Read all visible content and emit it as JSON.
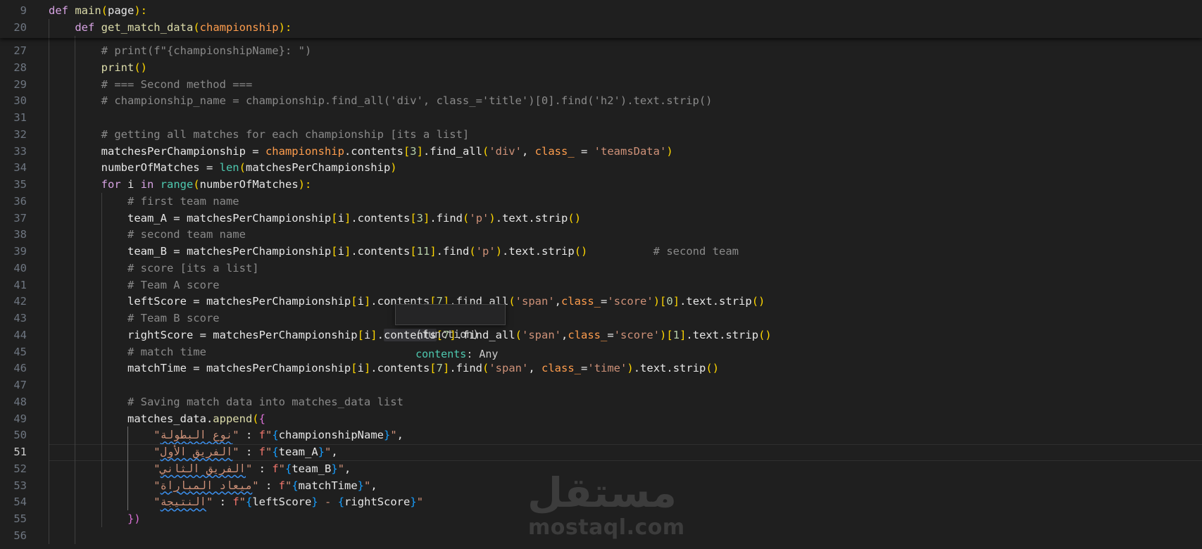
{
  "editor": {
    "sticky_lines": [
      {
        "number": "9",
        "tokens": [
          [
            "kw",
            "def "
          ],
          [
            "fn",
            "main"
          ],
          [
            "b1",
            "("
          ],
          [
            "var",
            "page"
          ],
          [
            "b1",
            "):"
          ]
        ]
      },
      {
        "number": "20",
        "tokens": [
          [
            "kw",
            "    def "
          ],
          [
            "fn",
            "get_match_data"
          ],
          [
            "b1",
            "("
          ],
          [
            "prm",
            "championship"
          ],
          [
            "b1",
            "):"
          ]
        ]
      }
    ],
    "active_line": "51",
    "lines": [
      {
        "number": "27",
        "tokens": [
          [
            "cm",
            "        # print(f\"{championshipName}: \")"
          ]
        ]
      },
      {
        "number": "28",
        "tokens": [
          [
            "fn",
            "        print"
          ],
          [
            "b1",
            "()"
          ]
        ]
      },
      {
        "number": "29",
        "tokens": [
          [
            "cm",
            "        # === Second method ==="
          ]
        ]
      },
      {
        "number": "30",
        "tokens": [
          [
            "cm",
            "        # championship_name = championship.find_all('div', class_='title')[0].find('h2').text.strip()"
          ]
        ]
      },
      {
        "number": "31",
        "tokens": []
      },
      {
        "number": "32",
        "tokens": [
          [
            "cm",
            "        # getting all matches for each championship [its a list]"
          ]
        ]
      },
      {
        "number": "33",
        "tokens": [
          [
            "var",
            "        matchesPerChampionship = "
          ],
          [
            "prm",
            "championship"
          ],
          [
            "var",
            ".contents"
          ],
          [
            "b1",
            "["
          ],
          [
            "num",
            "3"
          ],
          [
            "b1",
            "]"
          ],
          [
            "var",
            ".find_all"
          ],
          [
            "b1",
            "("
          ],
          [
            "str",
            "'div'"
          ],
          [
            "var",
            ", "
          ],
          [
            "prm",
            "class_"
          ],
          [
            "var",
            " = "
          ],
          [
            "str",
            "'teamsData'"
          ],
          [
            "b1",
            ")"
          ]
        ]
      },
      {
        "number": "34",
        "tokens": [
          [
            "var",
            "        numberOfMatches = "
          ],
          [
            "bi",
            "len"
          ],
          [
            "b1",
            "("
          ],
          [
            "var",
            "matchesPerChampionship"
          ],
          [
            "b1",
            ")"
          ]
        ]
      },
      {
        "number": "35",
        "tokens": [
          [
            "kw",
            "        for "
          ],
          [
            "var",
            "i "
          ],
          [
            "kw",
            "in "
          ],
          [
            "bi",
            "range"
          ],
          [
            "b1",
            "("
          ],
          [
            "var",
            "numberOfMatches"
          ],
          [
            "b1",
            "):"
          ]
        ]
      },
      {
        "number": "36",
        "tokens": [
          [
            "cm",
            "            # first team name"
          ]
        ]
      },
      {
        "number": "37",
        "tokens": [
          [
            "var",
            "            team_A = matchesPerChampionship"
          ],
          [
            "b1",
            "["
          ],
          [
            "var",
            "i"
          ],
          [
            "b1",
            "]"
          ],
          [
            "var",
            ".contents"
          ],
          [
            "b1",
            "["
          ],
          [
            "num",
            "3"
          ],
          [
            "b1",
            "]"
          ],
          [
            "var",
            ".find"
          ],
          [
            "b1",
            "("
          ],
          [
            "str",
            "'p'"
          ],
          [
            "b1",
            ")"
          ],
          [
            "var",
            ".text.strip"
          ],
          [
            "b1",
            "()"
          ]
        ]
      },
      {
        "number": "38",
        "tokens": [
          [
            "cm",
            "            # second team name"
          ]
        ]
      },
      {
        "number": "39",
        "tokens": [
          [
            "var",
            "            team_B = matchesPerChampionship"
          ],
          [
            "b1",
            "["
          ],
          [
            "var",
            "i"
          ],
          [
            "b1",
            "]"
          ],
          [
            "var",
            ".contents"
          ],
          [
            "b1",
            "["
          ],
          [
            "num",
            "11"
          ],
          [
            "b1",
            "]"
          ],
          [
            "var",
            ".find"
          ],
          [
            "b1",
            "("
          ],
          [
            "str",
            "'p'"
          ],
          [
            "b1",
            ")"
          ],
          [
            "var",
            ".text.strip"
          ],
          [
            "b1",
            "()"
          ],
          [
            "cm",
            "          # second team"
          ]
        ]
      },
      {
        "number": "40",
        "tokens": [
          [
            "cm",
            "            # score [its a list]"
          ]
        ]
      },
      {
        "number": "41",
        "tokens": [
          [
            "cm",
            "            # Team A score"
          ]
        ]
      },
      {
        "number": "42",
        "tokens": [
          [
            "var",
            "            leftScore = matchesPerChampionship"
          ],
          [
            "b1",
            "["
          ],
          [
            "var",
            "i"
          ],
          [
            "b1",
            "]"
          ],
          [
            "var",
            ".contents"
          ],
          [
            "b1",
            "["
          ],
          [
            "num",
            "7"
          ],
          [
            "b1",
            "]"
          ],
          [
            "var",
            ".find_all"
          ],
          [
            "b1",
            "("
          ],
          [
            "str",
            "'span'"
          ],
          [
            "var",
            ","
          ],
          [
            "prm",
            "class_"
          ],
          [
            "var",
            "="
          ],
          [
            "str",
            "'score'"
          ],
          [
            "b1",
            ")"
          ],
          [
            "b1",
            "["
          ],
          [
            "num",
            "0"
          ],
          [
            "b1",
            "]"
          ],
          [
            "var",
            ".text.strip"
          ],
          [
            "b1",
            "()"
          ]
        ]
      },
      {
        "number": "43",
        "tokens": [
          [
            "cm",
            "            # Team B score"
          ]
        ]
      },
      {
        "number": "44",
        "tokens": [
          [
            "var",
            "            rightScore = matchesPerChampionship"
          ],
          [
            "b1",
            "["
          ],
          [
            "var",
            "i"
          ],
          [
            "b1",
            "]"
          ],
          [
            "var",
            "."
          ],
          [
            "hover",
            "contents"
          ],
          [
            "b1",
            "["
          ],
          [
            "num",
            "7"
          ],
          [
            "b1",
            "]"
          ],
          [
            "var",
            ".find_all"
          ],
          [
            "b1",
            "("
          ],
          [
            "str",
            "'span'"
          ],
          [
            "var",
            ","
          ],
          [
            "prm",
            "class_"
          ],
          [
            "var",
            "="
          ],
          [
            "str",
            "'score'"
          ],
          [
            "b1",
            ")"
          ],
          [
            "b1",
            "["
          ],
          [
            "num",
            "1"
          ],
          [
            "b1",
            "]"
          ],
          [
            "var",
            ".text.strip"
          ],
          [
            "b1",
            "()"
          ]
        ]
      },
      {
        "number": "45",
        "tokens": [
          [
            "cm",
            "            # match time"
          ]
        ]
      },
      {
        "number": "46",
        "tokens": [
          [
            "var",
            "            matchTime = matchesPerChampionship"
          ],
          [
            "b1",
            "["
          ],
          [
            "var",
            "i"
          ],
          [
            "b1",
            "]"
          ],
          [
            "var",
            ".contents"
          ],
          [
            "b1",
            "["
          ],
          [
            "num",
            "7"
          ],
          [
            "b1",
            "]"
          ],
          [
            "var",
            ".find"
          ],
          [
            "b1",
            "("
          ],
          [
            "str",
            "'span'"
          ],
          [
            "var",
            ", "
          ],
          [
            "prm",
            "class_"
          ],
          [
            "var",
            "="
          ],
          [
            "str",
            "'time'"
          ],
          [
            "b1",
            ")"
          ],
          [
            "var",
            ".text.strip"
          ],
          [
            "b1",
            "()"
          ]
        ]
      },
      {
        "number": "47",
        "tokens": []
      },
      {
        "number": "48",
        "tokens": [
          [
            "cm",
            "            # Saving match data into matches_data list"
          ]
        ]
      },
      {
        "number": "49",
        "tokens": [
          [
            "var",
            "            matches_data."
          ],
          [
            "fn",
            "append"
          ],
          [
            "b1",
            "("
          ],
          [
            "b2",
            "{"
          ]
        ]
      },
      {
        "number": "50",
        "tokens": [
          [
            "str",
            "                \""
          ],
          [
            "ar",
            "نوع البطولة"
          ],
          [
            "str",
            "\""
          ],
          [
            "var",
            " : "
          ],
          [
            "fstr",
            "f"
          ],
          [
            "str",
            "\""
          ],
          [
            "b3",
            "{"
          ],
          [
            "var",
            "championshipName"
          ],
          [
            "b3",
            "}"
          ],
          [
            "str",
            "\""
          ],
          [
            "var",
            ","
          ]
        ]
      },
      {
        "number": "51",
        "tokens": [
          [
            "str",
            "                \""
          ],
          [
            "ar",
            "الفريق الأول"
          ],
          [
            "str",
            "\""
          ],
          [
            "var",
            " : "
          ],
          [
            "fstr",
            "f"
          ],
          [
            "str",
            "\""
          ],
          [
            "b3",
            "{"
          ],
          [
            "var",
            "team_A"
          ],
          [
            "b3",
            "}"
          ],
          [
            "str",
            "\""
          ],
          [
            "var",
            ","
          ]
        ]
      },
      {
        "number": "52",
        "tokens": [
          [
            "str",
            "                \""
          ],
          [
            "ar",
            "الفريق الثاني"
          ],
          [
            "str",
            "\""
          ],
          [
            "var",
            " : "
          ],
          [
            "fstr",
            "f"
          ],
          [
            "str",
            "\""
          ],
          [
            "b3",
            "{"
          ],
          [
            "var",
            "team_B"
          ],
          [
            "b3",
            "}"
          ],
          [
            "str",
            "\""
          ],
          [
            "var",
            ","
          ]
        ]
      },
      {
        "number": "53",
        "tokens": [
          [
            "str",
            "                \""
          ],
          [
            "ar",
            "ميعاد المباراة"
          ],
          [
            "str",
            "\""
          ],
          [
            "var",
            " : "
          ],
          [
            "fstr",
            "f"
          ],
          [
            "str",
            "\""
          ],
          [
            "b3",
            "{"
          ],
          [
            "var",
            "matchTime"
          ],
          [
            "b3",
            "}"
          ],
          [
            "str",
            "\""
          ],
          [
            "var",
            ","
          ]
        ]
      },
      {
        "number": "54",
        "tokens": [
          [
            "str",
            "                \""
          ],
          [
            "ar",
            "النتيجة"
          ],
          [
            "str",
            "\""
          ],
          [
            "var",
            " : "
          ],
          [
            "fstr",
            "f"
          ],
          [
            "str",
            "\""
          ],
          [
            "b3",
            "{"
          ],
          [
            "var",
            "leftScore"
          ],
          [
            "b3",
            "}"
          ],
          [
            "str",
            " - "
          ],
          [
            "b3",
            "{"
          ],
          [
            "var",
            "rightScore"
          ],
          [
            "b3",
            "}"
          ],
          [
            "str",
            "\""
          ]
        ]
      },
      {
        "number": "55",
        "tokens": [
          [
            "b2",
            "            })"
          ]
        ]
      },
      {
        "number": "56",
        "tokens": []
      }
    ]
  },
  "tooltip": {
    "kind": "(function)",
    "name": "contents",
    "type": ": Any"
  },
  "watermark": {
    "logo_text": "مستقل",
    "site": "mostaql.com"
  }
}
